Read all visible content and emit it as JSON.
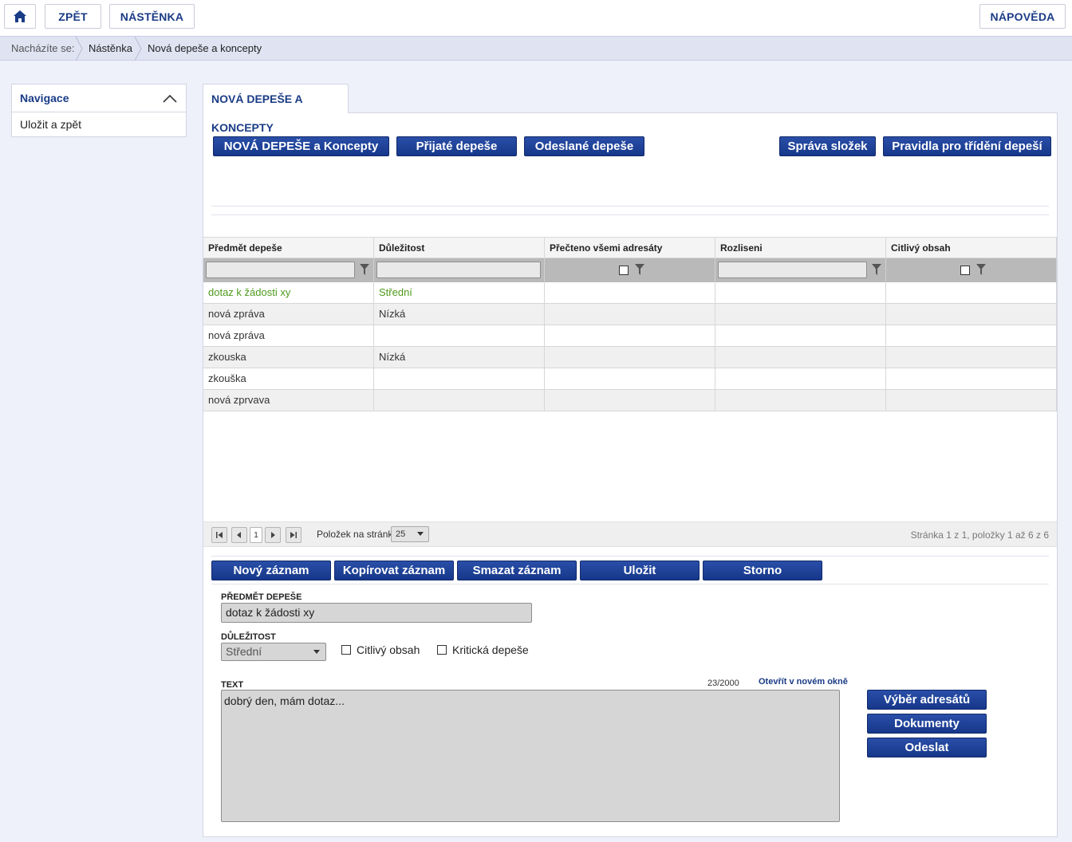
{
  "topbar": {
    "home_icon": "home-icon",
    "back": "ZPĚT",
    "dashboard": "NÁSTĚNKA",
    "help": "NÁPOVĚDA"
  },
  "breadcrumb": {
    "prefix": "Nacházíte se:",
    "items": [
      "Nástěnka",
      "Nová depeše a koncepty"
    ]
  },
  "nav": {
    "title": "Navigace",
    "items": [
      "Uložit a zpět"
    ]
  },
  "tab": {
    "label": "NOVÁ DEPEŠE A KONCEPTY"
  },
  "actions": {
    "new_and_drafts": "NOVÁ DEPEŠE a Koncepty",
    "received": "Přijaté depeše",
    "sent": "Odeslané depeše",
    "folders": "Správa složek",
    "rules": "Pravidla pro třídění depeší"
  },
  "grid": {
    "columns": [
      "Předmět depeše",
      "Důležitost",
      "Přečteno všemi adresáty",
      "Rozliseni",
      "Citlivý obsah"
    ],
    "rows": [
      [
        "dotaz k žádosti xy",
        "Střední",
        "",
        "",
        ""
      ],
      [
        "nová zpráva",
        "Nízká",
        "",
        "",
        ""
      ],
      [
        "nová zpráva",
        "",
        "",
        "",
        ""
      ],
      [
        "zkouska",
        "Nízká",
        "",
        "",
        ""
      ],
      [
        "zkouška",
        "",
        "",
        "",
        ""
      ],
      [
        "nová zprvava",
        "",
        "",
        "",
        ""
      ]
    ],
    "selected_row": 0
  },
  "pager": {
    "current_page": "1",
    "page_size_label": "Položek na stránku",
    "page_size": "25",
    "summary": "Stránka 1 z 1, položky 1 až 6 z 6"
  },
  "record_actions": {
    "new": "Nový záznam",
    "copy": "Kopírovat záznam",
    "delete": "Smazat záznam",
    "save": "Uložit",
    "cancel": "Storno"
  },
  "form": {
    "subject_label": "PŘEDMĚT DEPEŠE",
    "subject_value": "dotaz k žádosti xy",
    "importance_label": "DŮLEŽITOST",
    "importance_value": "Střední",
    "sensitive_label": "Citlivý obsah",
    "critical_label": "Kritická depeše",
    "text_label": "TEXT",
    "text_count": "23/2000",
    "open_new_window": "Otevřít v novém okně",
    "text_value": "dobrý den, mám dotaz..."
  },
  "side_actions": {
    "recipients": "Výběr adresátů",
    "documents": "Dokumenty",
    "send": "Odeslat"
  },
  "colors": {
    "brand_blue": "#1a3b86",
    "button_blue": "#1f43a0",
    "selected_row_text": "#4e9a1c"
  }
}
